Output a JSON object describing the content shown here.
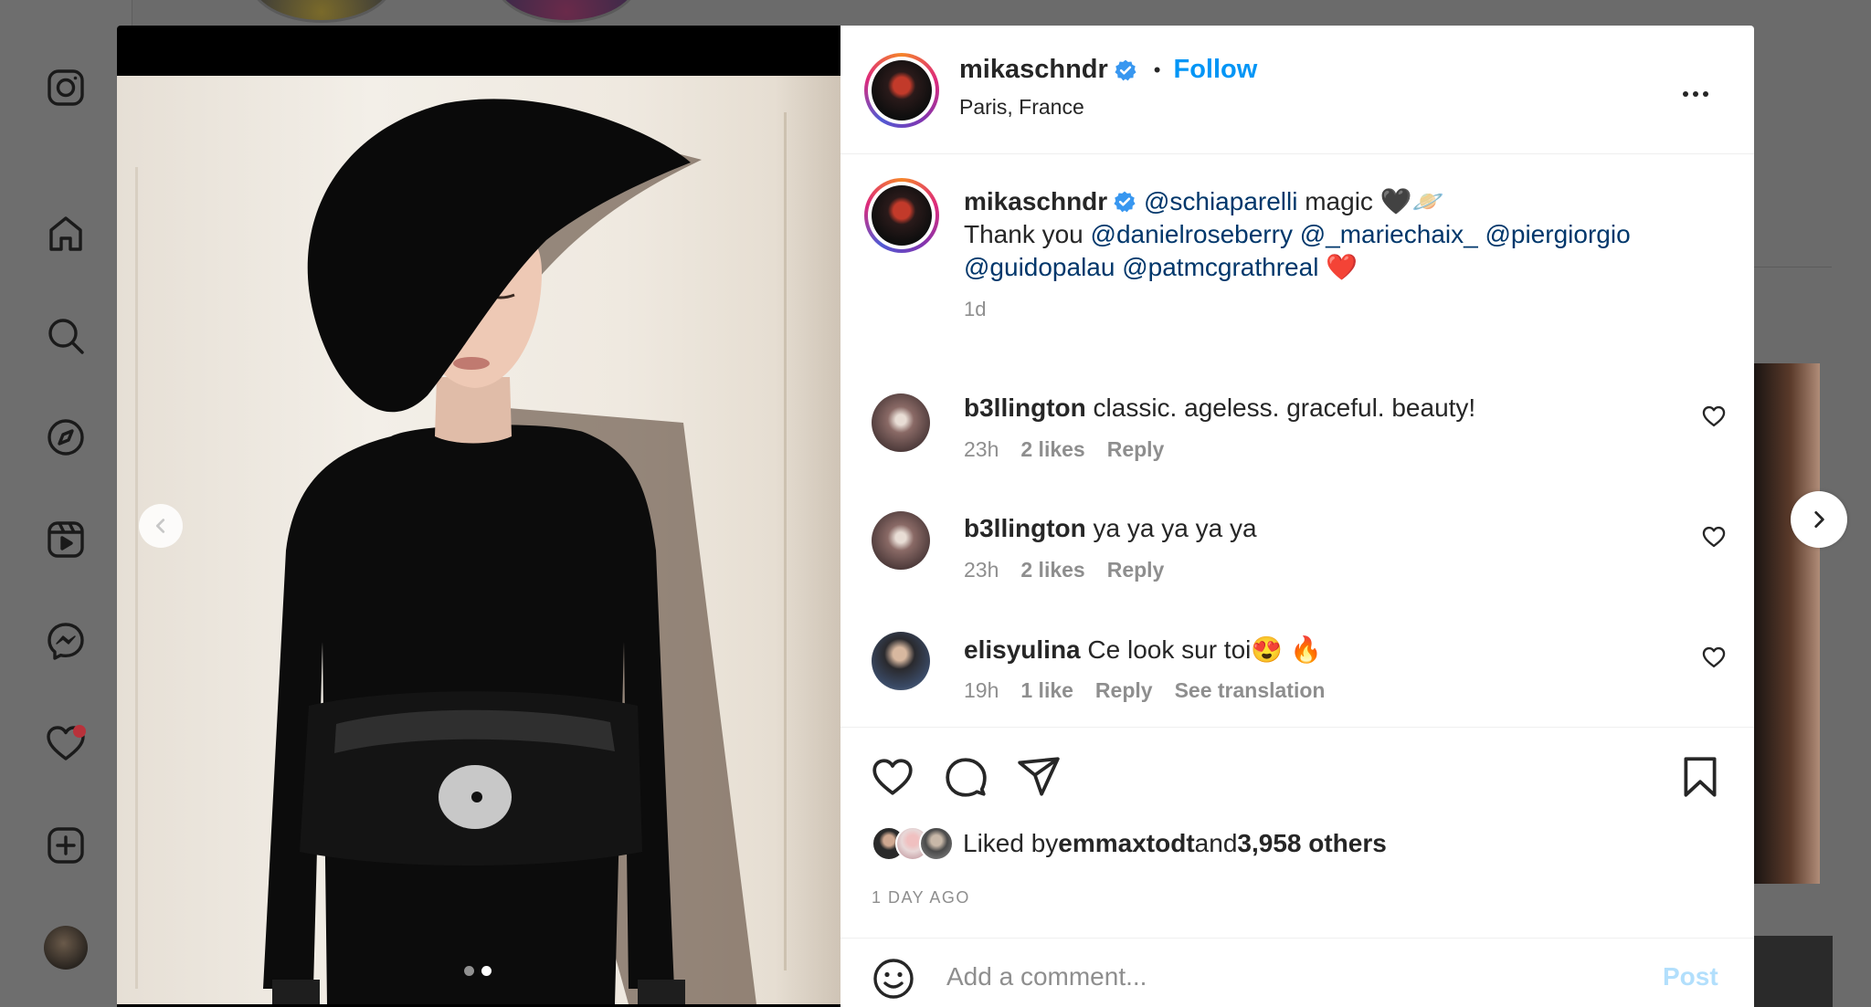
{
  "post": {
    "username": "mikaschndr",
    "separator": "•",
    "follow_label": "Follow",
    "location": "Paris, France",
    "caption": {
      "username": "mikaschndr",
      "mention_1": "@schiaparelli",
      "text_1": " magic 🖤🪐",
      "text_2": "Thank you ",
      "mention_2": "@danielroseberry",
      "mention_3": "@_mariechaix_",
      "mention_4": "@piergiorgio",
      "mention_5": "@guidopalau",
      "mention_6": "@patmcgrathreal",
      "text_3": " ❤️",
      "time": "1d"
    },
    "comments": [
      {
        "username": "b3llington",
        "text": "classic. ageless. graceful. beauty!",
        "time": "23h",
        "likes": "2 likes",
        "reply": "Reply",
        "translation": ""
      },
      {
        "username": "b3llington",
        "text": "ya ya ya ya ya",
        "time": "23h",
        "likes": "2 likes",
        "reply": "Reply",
        "translation": ""
      },
      {
        "username": "elisyulina",
        "text": "Ce look sur toi😍 🔥",
        "time": "19h",
        "likes": "1 like",
        "reply": "Reply",
        "translation": "See translation"
      }
    ],
    "liked_by": {
      "prefix": "Liked by ",
      "user": "emmaxtodt",
      "middle": " and ",
      "others": "3,958 others"
    },
    "posted_ago": "1 DAY AGO",
    "comment_placeholder": "Add a comment...",
    "post_label": "Post",
    "carousel": {
      "count": 2,
      "active_index": 1
    }
  },
  "icons": [
    "instagram-icon",
    "home-icon",
    "search-icon",
    "explore-icon",
    "reels-icon",
    "messenger-icon",
    "heart-icon",
    "create-icon",
    "more-icon",
    "like-icon",
    "comment-icon",
    "share-icon",
    "save-icon",
    "emoji-icon",
    "chevron-left-icon",
    "chevron-right-icon",
    "verified-icon"
  ],
  "colors": {
    "link": "#0095f6",
    "mention": "#00376b",
    "muted": "#8e8e8e",
    "notification": "#b8323b",
    "post_disabled": "#b2dffc"
  }
}
